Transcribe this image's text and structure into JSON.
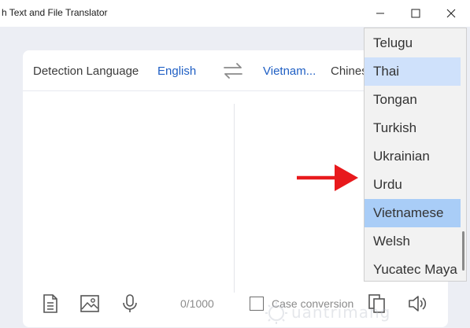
{
  "window": {
    "title": "h Text and File Translator",
    "controls": {
      "minimize": "minimize-icon",
      "maximize": "maximize-icon",
      "close": "close-icon"
    }
  },
  "langbar": {
    "source_label": "Detection Language",
    "source_active": "English",
    "swap_icon": "swap-arrows-icon",
    "target_active": "Vietnam...",
    "target_other": "Chines"
  },
  "toolbar": {
    "counter": "0/1000",
    "case_conversion": "Case conversion",
    "icons": [
      "document-icon",
      "image-icon",
      "microphone-icon",
      "copy-icon",
      "speaker-icon"
    ]
  },
  "dropdown": {
    "items": [
      "Telugu",
      "Thai",
      "Tongan",
      "Turkish",
      "Ukrainian",
      "Urdu",
      "Vietnamese",
      "Welsh",
      "Yucatec Maya"
    ],
    "hovered": "Thai",
    "selected": "Vietnamese"
  },
  "watermark": {
    "text": "uantrimang"
  },
  "colors": {
    "accent": "#1f5fc4",
    "selected": "#a9cdf7",
    "hover": "#cfe1fb",
    "arrow": "#e8191c"
  }
}
